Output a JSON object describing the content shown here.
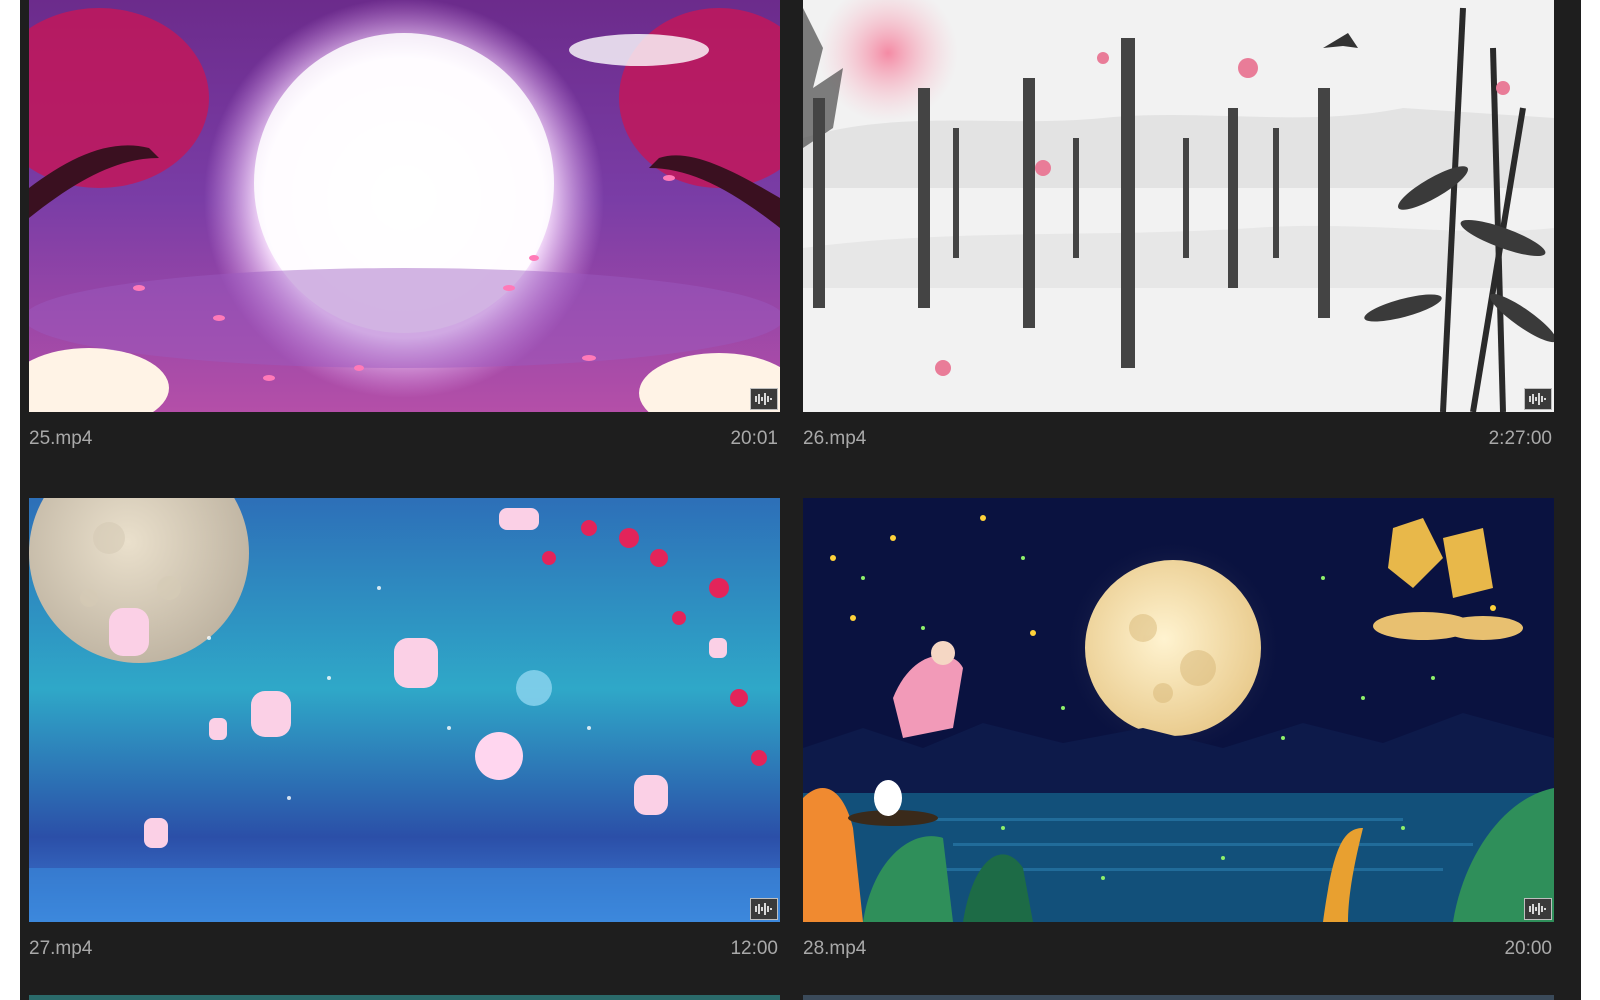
{
  "media_bin": {
    "items": [
      {
        "filename": "25.mp4",
        "duration": "20:01",
        "badge_icon": "audio-waveform-icon",
        "theme": "pink moon with plum blossoms"
      },
      {
        "filename": "26.mp4",
        "duration": "2:27:00",
        "badge_icon": "audio-waveform-icon",
        "theme": "ink painting with calligraphy and bamboo"
      },
      {
        "filename": "27.mp4",
        "duration": "12:00",
        "badge_icon": "audio-waveform-icon",
        "theme": "blue sky lanterns and full moon"
      },
      {
        "filename": "28.mp4",
        "duration": "20:00",
        "badge_icon": "audio-waveform-icon",
        "theme": "night moon over lake with rabbit"
      }
    ],
    "colors": {
      "panel_bg": "#1e1e1e",
      "caption_text": "#a9a9a9"
    }
  }
}
